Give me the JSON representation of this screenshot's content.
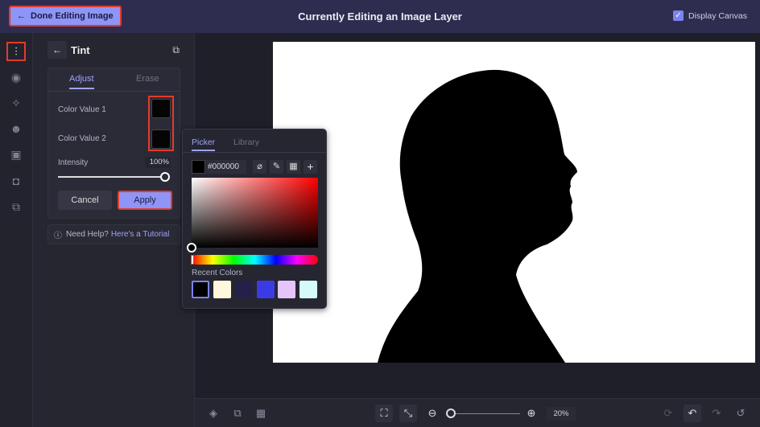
{
  "header": {
    "done_label": "Done Editing Image",
    "title": "Currently Editing an Image Layer",
    "display_canvas_label": "Display Canvas",
    "display_canvas_checked": true
  },
  "rail": {
    "icons": [
      "adjust-sliders-icon",
      "eye-icon",
      "sparkle-effects-icon",
      "palette-icon",
      "frame-icon",
      "border-icon",
      "mask-icon"
    ]
  },
  "panel": {
    "title": "Tint",
    "tabs": [
      "Adjust",
      "Erase"
    ],
    "active_tab": "Adjust",
    "color_value_1_label": "Color Value 1",
    "color_value_1": "#000000",
    "color_value_2_label": "Color Value 2",
    "color_value_2": "#000000",
    "intensity_label": "Intensity",
    "intensity_value": "100%",
    "intensity_fraction": 1.0,
    "cancel_label": "Cancel",
    "apply_label": "Apply",
    "help_text": "Need Help?",
    "help_link": "Here's a Tutorial"
  },
  "picker": {
    "tabs": [
      "Picker",
      "Library"
    ],
    "active_tab": "Picker",
    "hex_value": "#000000",
    "recent_label": "Recent Colors",
    "recent_colors": [
      "#000000",
      "#fff8dc",
      "#23214a",
      "#3b3be6",
      "#e4c4fa",
      "#d4fbfa"
    ]
  },
  "bottom": {
    "zoom_value": "20%"
  },
  "colors": {
    "accent": "#8e95f7",
    "highlight": "#e23b2b",
    "topbar": "#2e2d50"
  }
}
